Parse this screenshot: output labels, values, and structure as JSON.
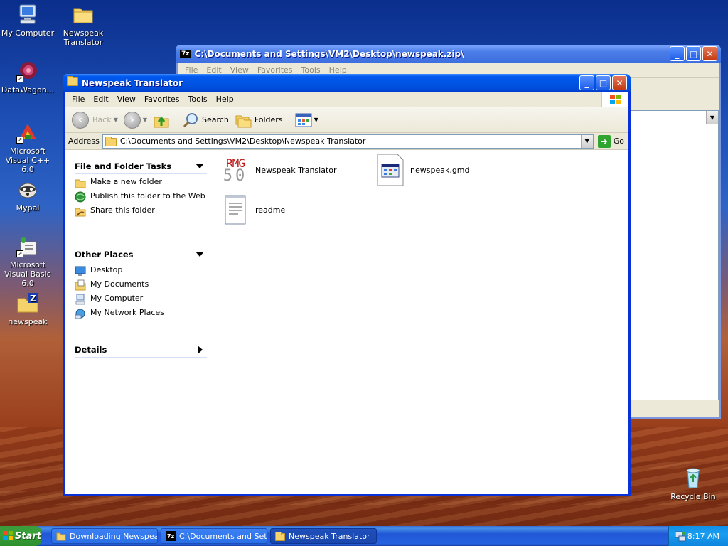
{
  "desktop": {
    "icons": [
      {
        "label": "My Computer",
        "icon": "my-computer-icon"
      },
      {
        "label": "Newspeak Translator",
        "icon": "folder-icon"
      },
      {
        "label": "DataWagon...",
        "icon": "datawagon-icon"
      },
      {
        "label": "Microsoft Visual C++ 6.0",
        "icon": "visual-cpp-icon"
      },
      {
        "label": "Mypal",
        "icon": "mypal-icon"
      },
      {
        "label": "Microsoft Visual Basic 6.0",
        "icon": "visual-basic-icon"
      },
      {
        "label": "newspeak",
        "icon": "zip-archive-icon"
      },
      {
        "label": "Recycle Bin",
        "icon": "recycle-bin-icon"
      }
    ]
  },
  "zip_window": {
    "title": "C:\\Documents and Settings\\VM2\\Desktop\\newspeak.zip\\",
    "app_badge": "7z",
    "menu": [
      "File",
      "Edit",
      "View",
      "Favorites",
      "Tools",
      "Help"
    ]
  },
  "explorer": {
    "title": "Newspeak Translator",
    "menu": [
      "File",
      "Edit",
      "View",
      "Favorites",
      "Tools",
      "Help"
    ],
    "toolbar": {
      "back": "Back",
      "search": "Search",
      "folders": "Folders"
    },
    "address": {
      "label": "Address",
      "value": "C:\\Documents and Settings\\VM2\\Desktop\\Newspeak Translator",
      "go": "Go"
    },
    "tasks": {
      "file_folder": {
        "title": "File and Folder Tasks",
        "items": [
          "Make a new folder",
          "Publish this folder to the Web",
          "Share this folder"
        ]
      },
      "other_places": {
        "title": "Other Places",
        "items": [
          "Desktop",
          "My Documents",
          "My Computer",
          "My Network Places"
        ]
      },
      "details": {
        "title": "Details"
      }
    },
    "files": [
      {
        "name": "Newspeak Translator",
        "icon_text_top": "RMG",
        "icon_text_bottom": "50"
      },
      {
        "name": "newspeak.gmd"
      },
      {
        "name": "readme"
      }
    ]
  },
  "taskbar": {
    "start": "Start",
    "items": [
      {
        "label": "Downloading Newspea..."
      },
      {
        "label": "C:\\Documents and Set..."
      },
      {
        "label": "Newspeak Translator"
      }
    ],
    "clock": "8:17 AM"
  },
  "colors": {
    "title_active": "#0054e3",
    "taskbar": "#2157d7",
    "start_green": "#37a237"
  }
}
